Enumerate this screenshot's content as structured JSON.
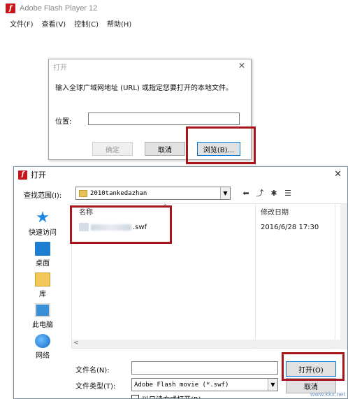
{
  "main_window": {
    "title": "Adobe Flash Player 12",
    "menu": [
      "文件(F)",
      "查看(V)",
      "控制(C)",
      "帮助(H)"
    ]
  },
  "open_dialog": {
    "title": "打开",
    "message": "输入全球广域网地址 (URL) 或指定您要打开的本地文件。",
    "location_label": "位置:",
    "location_value": "",
    "ok_label": "确定",
    "cancel_label": "取消",
    "browse_label": "浏览(B)..."
  },
  "file_dialog": {
    "title": "打开",
    "lookin_label": "查找范围(I):",
    "lookin_value": "2010tankedazhan",
    "places": [
      {
        "label": "快速访问",
        "icon": "star-icon"
      },
      {
        "label": "桌面",
        "icon": "desktop-icon"
      },
      {
        "label": "库",
        "icon": "library-icon"
      },
      {
        "label": "此电脑",
        "icon": "computer-icon"
      },
      {
        "label": "网络",
        "icon": "network-icon"
      }
    ],
    "columns": {
      "name": "名称",
      "date": "修改日期"
    },
    "files": [
      {
        "name": ".swf",
        "date": "2016/6/28 17:30"
      }
    ],
    "filename_label": "文件名(N):",
    "filename_value": "",
    "filetype_label": "文件类型(T):",
    "filetype_value": "Adobe Flash movie (*.swf)",
    "open_label": "打开(O)",
    "cancel_label": "取消",
    "readonly_label": "以只读方式打开(R)"
  },
  "watermark": "www.kkx.net",
  "colors": {
    "highlight": "#a5161d",
    "flash_red": "#c8161d",
    "accent": "#0078d7"
  }
}
